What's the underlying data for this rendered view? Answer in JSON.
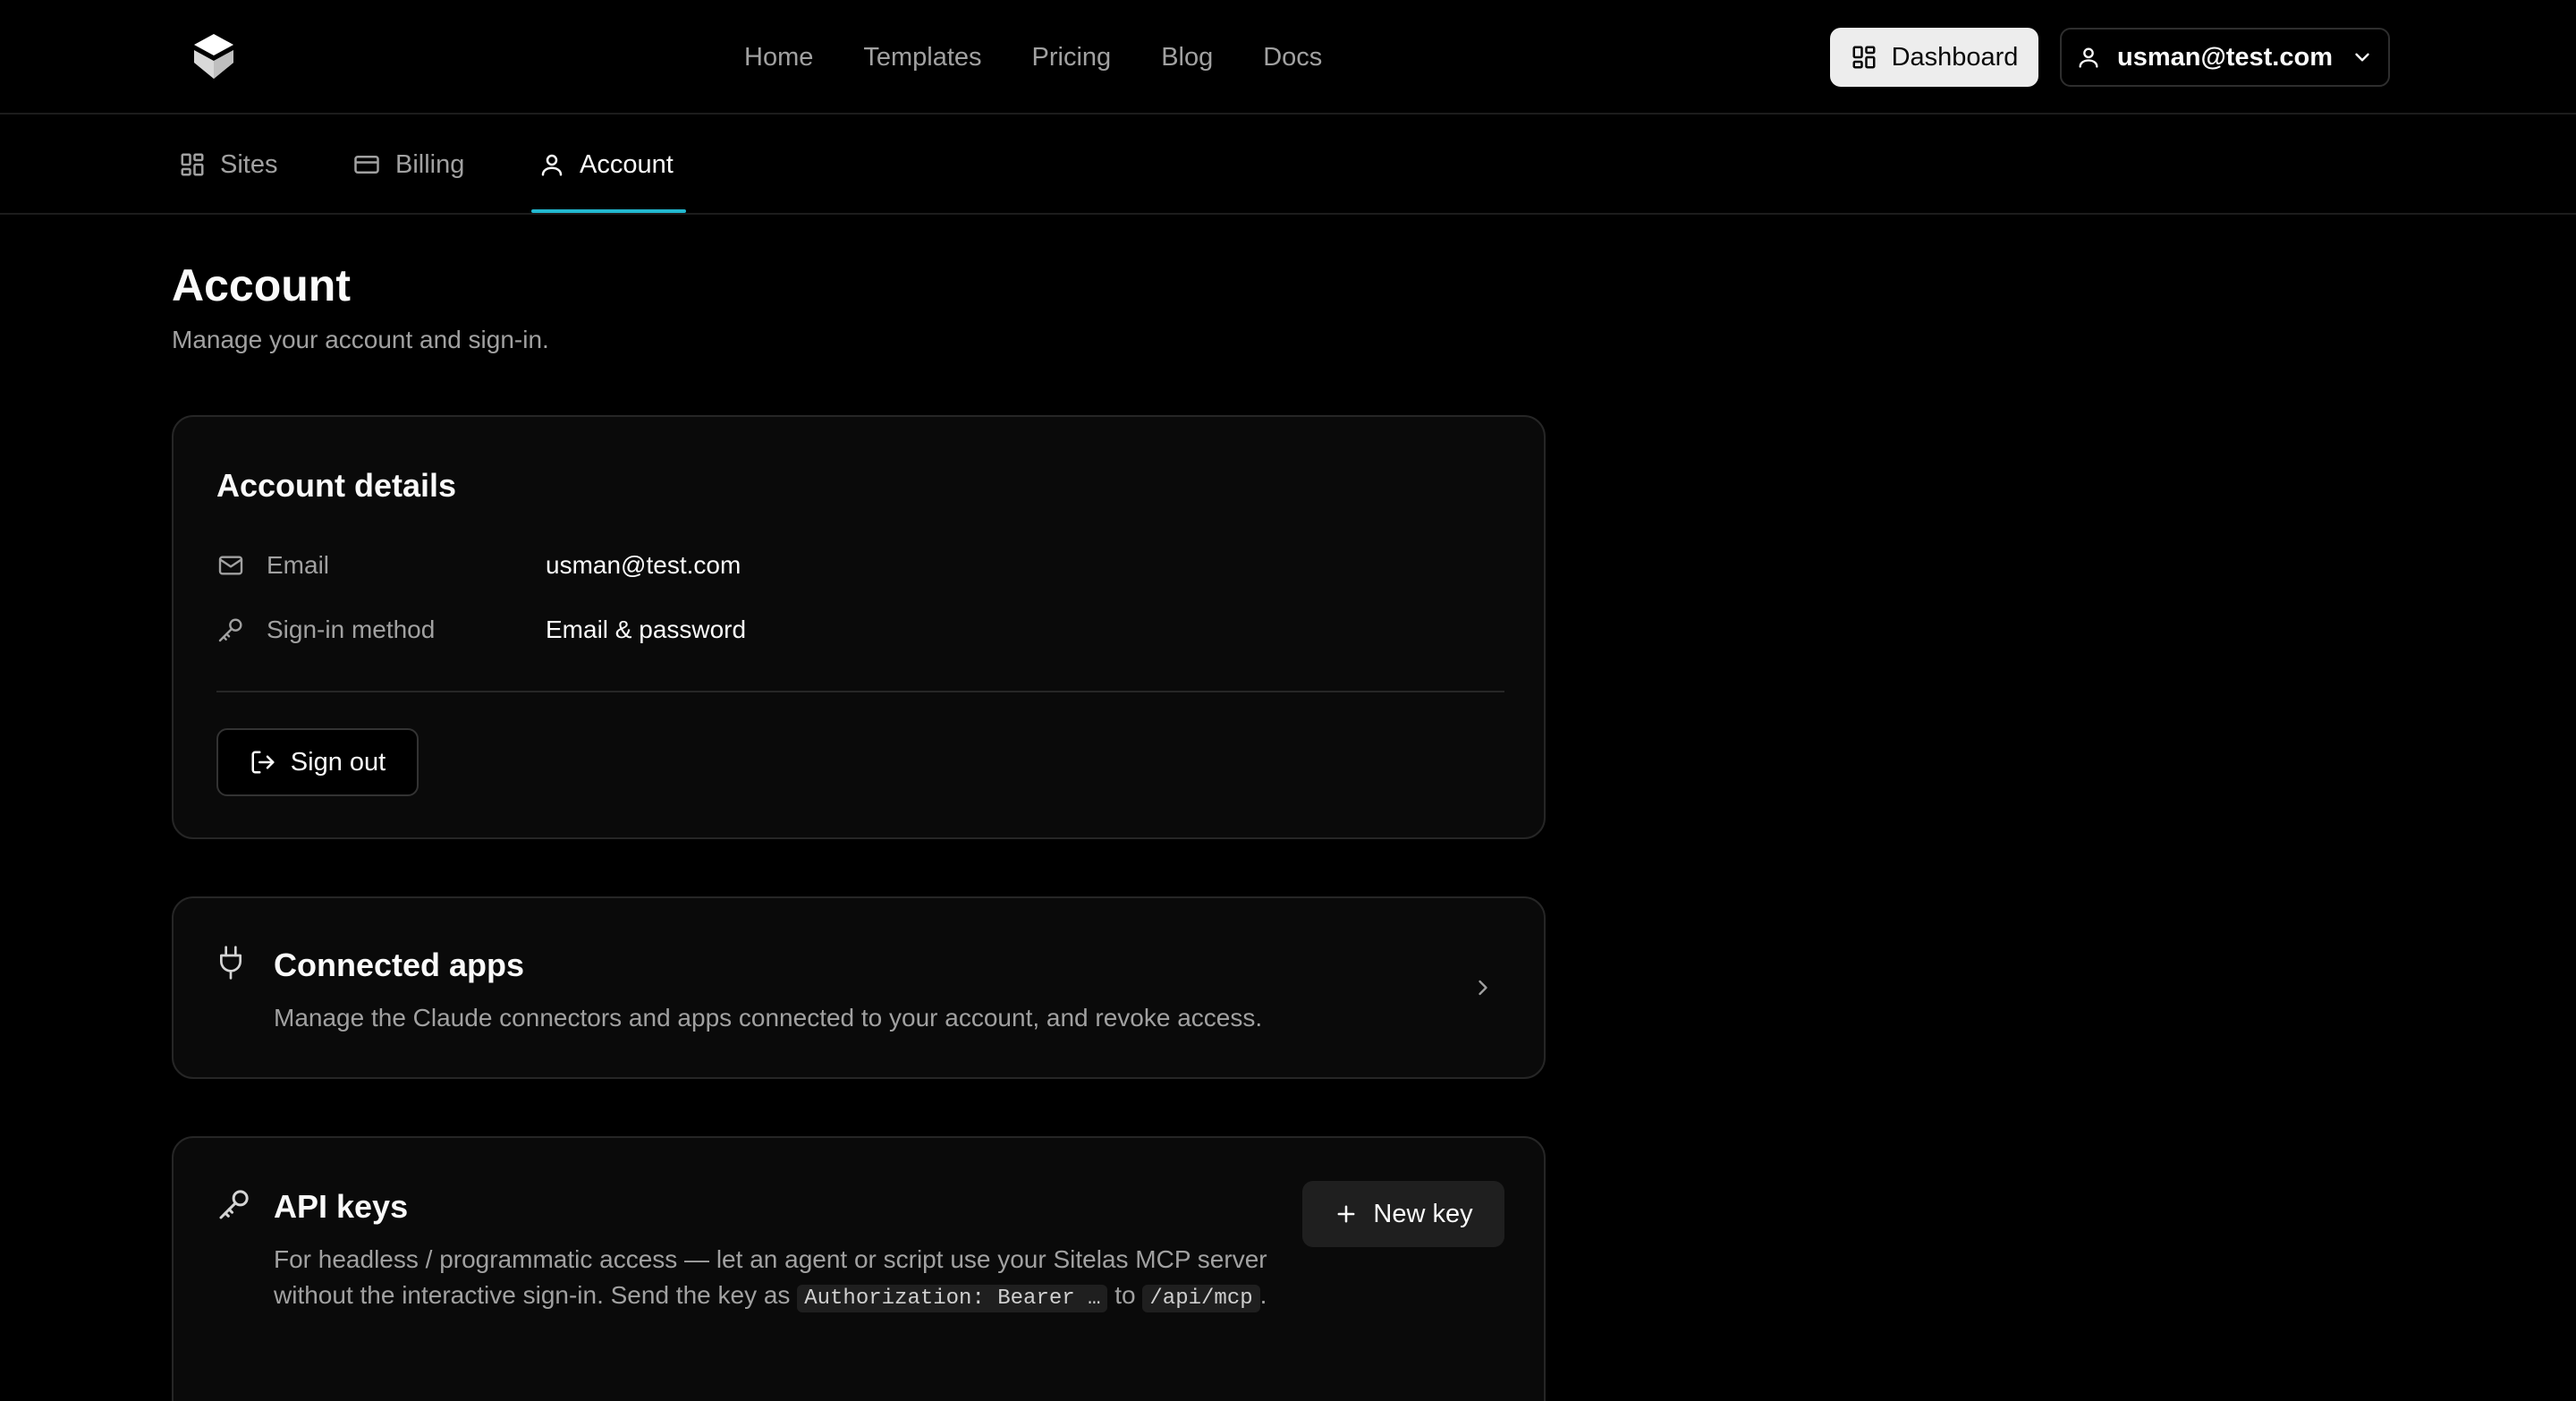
{
  "nav": {
    "logo_icon": "layers-logo-icon",
    "links": [
      "Home",
      "Templates",
      "Pricing",
      "Blog",
      "Docs"
    ],
    "dashboard_label": "Dashboard",
    "dashboard_icon": "grid-icon",
    "user_email": "usman@test.com",
    "user_icon": "user-icon",
    "user_menu_icon": "chevron-down-icon"
  },
  "tabs": [
    {
      "label": "Sites",
      "icon": "grid-icon"
    },
    {
      "label": "Billing",
      "icon": "credit-card-icon"
    },
    {
      "label": "Account",
      "icon": "user-icon",
      "active": true
    }
  ],
  "page": {
    "title": "Account",
    "subtitle": "Manage your account and sign-in."
  },
  "account_details": {
    "title": "Account details",
    "email_label": "Email",
    "email_value": "usman@test.com",
    "method_label": "Sign-in method",
    "method_value": "Email & password",
    "sign_out_label": "Sign out"
  },
  "connected_apps": {
    "title": "Connected apps",
    "description": "Manage the Claude connectors and apps connected to your account, and revoke access."
  },
  "api_keys": {
    "title": "API keys",
    "desc_part1": "For headless / programmatic access — let an agent or script use your Sitelas MCP server without the interactive sign-in. Send the key as ",
    "code_auth": "Authorization: Bearer …",
    "desc_part2": " to ",
    "code_path": "/api/mcp",
    "desc_part3": ".",
    "new_key_label": "New key"
  },
  "colors": {
    "background": "#000000",
    "card": "#0a0a0a",
    "border": "#262626",
    "accent_tab": "#22b8cf",
    "muted_text": "#a1a1a1"
  }
}
